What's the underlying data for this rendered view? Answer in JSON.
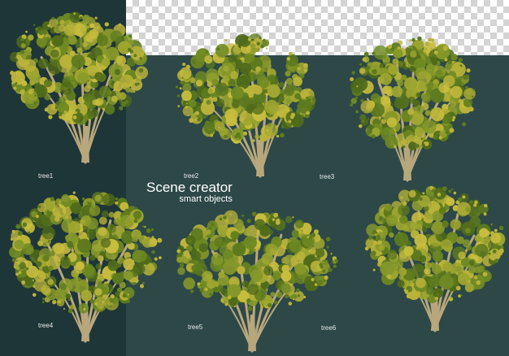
{
  "trees": [
    {
      "label": "tree1"
    },
    {
      "label": "tree2"
    },
    {
      "label": "tree3"
    },
    {
      "label": "tree4"
    },
    {
      "label": "tree5"
    },
    {
      "label": "tree6"
    }
  ],
  "headline": {
    "title": "Scene creator",
    "subtitle": "smart objects"
  },
  "colors": {
    "left_background": "#1f3638",
    "right_background": "#2d4847",
    "foliage_dark": "#5d7a1e",
    "foliage_light": "#b9b33a",
    "trunk": "#b8a77c"
  }
}
